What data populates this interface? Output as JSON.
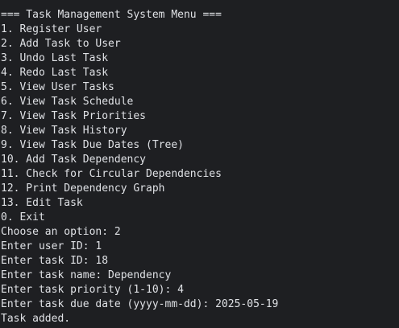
{
  "terminal": {
    "menu_header": "=== Task Management System Menu ===",
    "menu_items": [
      "1. Register User",
      "2. Add Task to User",
      "3. Undo Last Task",
      "4. Redo Last Task",
      "5. View User Tasks",
      "6. View Task Schedule",
      "7. View Task Priorities",
      "8. View Task History",
      "9. View Task Due Dates (Tree)",
      "10. Add Task Dependency",
      "11. Check for Circular Dependencies",
      "12. Print Dependency Graph",
      "13. Edit Task",
      "0. Exit"
    ],
    "session": [
      "Choose an option: 2",
      "Enter user ID: 1",
      "Enter task ID: 18",
      "Enter task name: Dependency",
      "Enter task priority (1-10): 4",
      "Enter task due date (yyyy-mm-dd): 2025-05-19",
      "Task added."
    ],
    "colors": {
      "background": "#1e1f22",
      "text": "#dfe1e5"
    }
  }
}
